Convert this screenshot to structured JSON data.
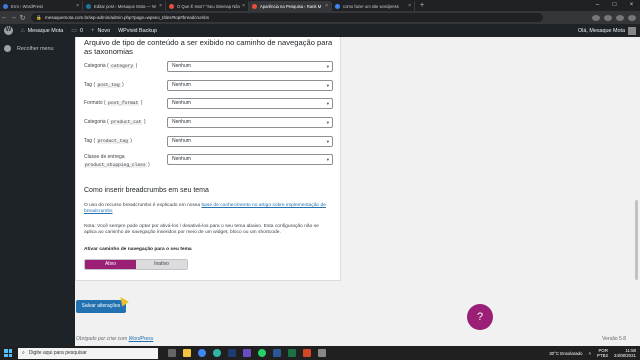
{
  "browser": {
    "tabs": [
      {
        "label": "Erro ‹ WordPress",
        "color": "#3d79d8",
        "active": false
      },
      {
        "label": "Editar post ‹ Mesaque Mota — W",
        "color": "#21759b",
        "active": false
      },
      {
        "label": "O Que É Isso? \"Seu Sitemap Não",
        "color": "#e94e3c",
        "active": false
      },
      {
        "label": "Aparência na Pesquisa ‹ Rank M",
        "color": "#e94e3c",
        "active": true
      },
      {
        "label": "como fazer um site wordpress",
        "color": "#4285f4",
        "active": false
      }
    ],
    "new_tab": "+",
    "url": "mesaquemota.com.br/wp-admin/admin.php?page=wpseo_titles#top#breadcrumbs"
  },
  "admin_bar": {
    "site_name": "Mesaque Mota",
    "comments_count": "0",
    "new_label": "Novo",
    "backup_label": "WPvivid Backup",
    "greeting": "Olá, Mesaque Mota"
  },
  "sidebar": {
    "collapse_label": "Recolher menu"
  },
  "main": {
    "section_title": "Arquivo de tipo de conteúdo a ser exibido no caminho de navegação para as taxonomias",
    "rows": [
      {
        "label": "Categoria",
        "code": "category",
        "value": "Nenhum"
      },
      {
        "label": "Tag",
        "code": "post_tag",
        "value": "Nenhum"
      },
      {
        "label": "Formato",
        "code": "post_format",
        "value": "Nenhum"
      },
      {
        "label": "Categoria",
        "code": "product_cat",
        "value": "Nenhum"
      },
      {
        "label": "Tag",
        "code": "product_tag",
        "value": "Nenhum"
      },
      {
        "label": "Classe de entrega",
        "code": "product_shipping_class",
        "value": "Nenhum"
      }
    ],
    "howto_title": "Como inserir breadcrumbs em seu tema",
    "howto_text": "O uso do recurso breadcrumbs é explicado em nossa",
    "howto_link": "base de conhecimento no artigo sobre implementação de breadcrumbs",
    "note_text": "Nota: Você sempre pode optar por ativá-los / desativá-los para o seu tema abaixo. Esta configuração não se aplica ao caminho de navegação inseridos por meio de um widget, bloco ou um shortcode.",
    "toggle_label": "Ativar caminho de navegação para o seu tema",
    "toggle_on": "Ativo",
    "toggle_off": "Inativo",
    "save_label": "Salvar alterações"
  },
  "footer": {
    "text": "Obrigado por criar com",
    "link": "WordPress",
    "version": "Versão 5.8"
  },
  "help_button": "?",
  "taskbar": {
    "search_placeholder": "Digite aqui para pesquisar",
    "weather": "30°C  Ensolarado",
    "lang1": "POR",
    "lang2": "PTB2",
    "time": "11:58",
    "date": "24/08/2021"
  }
}
